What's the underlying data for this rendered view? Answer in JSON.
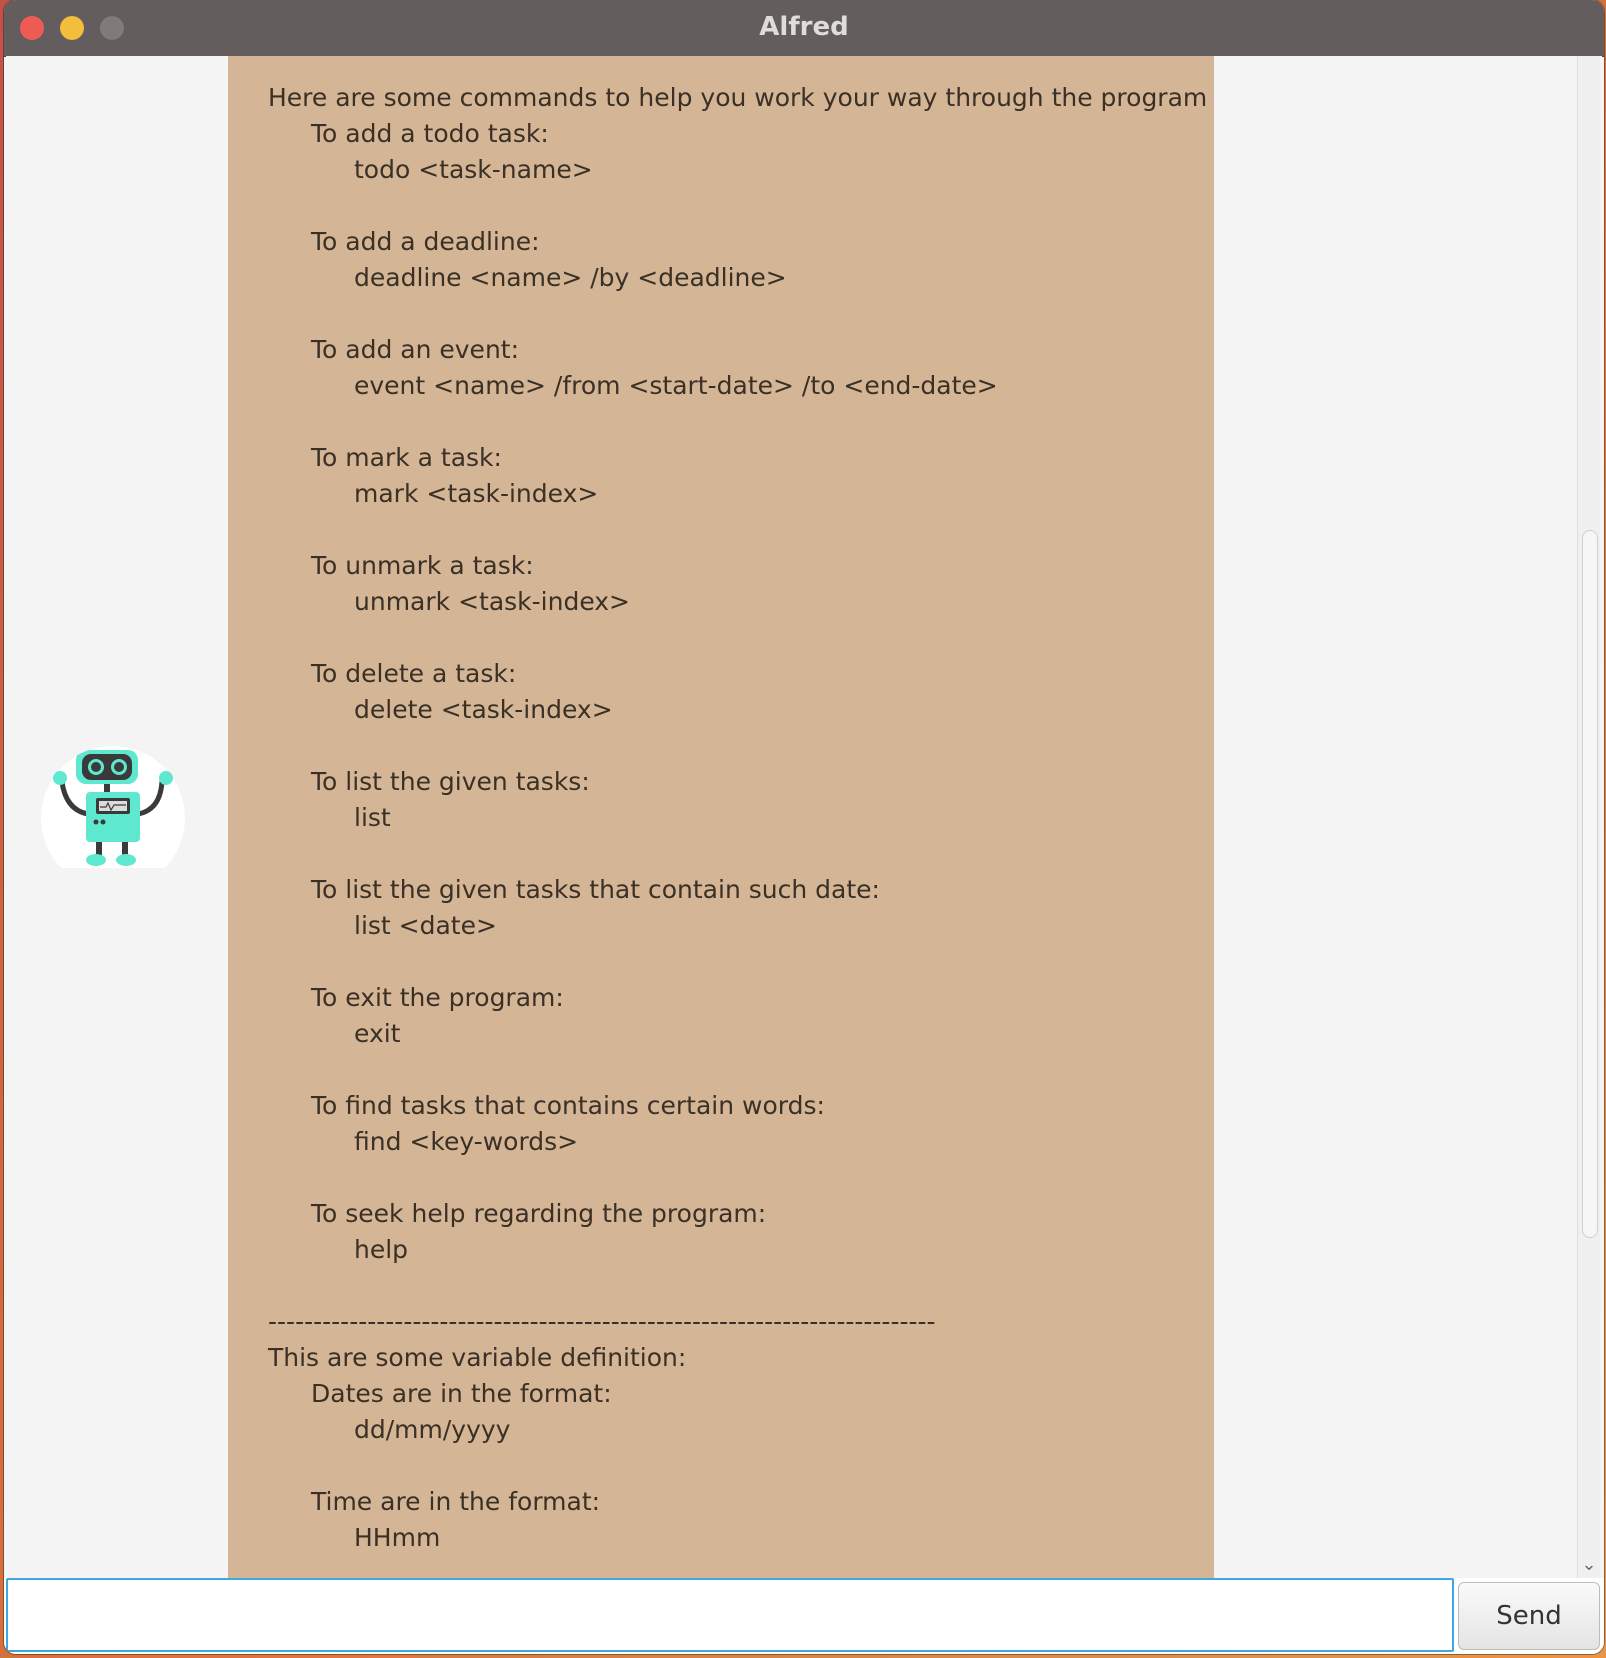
{
  "window": {
    "title": "Alfred",
    "traffic_lights": [
      "close",
      "minimize",
      "maximize"
    ]
  },
  "chat": {
    "avatar": {
      "icon": "robot-icon",
      "colors": {
        "body": "#5ee8cf",
        "outline": "#3a3a3a"
      }
    },
    "bubble_color": "#d4b696",
    "message_lines": [
      {
        "text": "--------------------------------------------------------------------------",
        "indent": 0,
        "cut": true
      },
      {
        "text": "Here are some commands to help you work your way through the program :)",
        "indent": 0
      },
      {
        "text": "To add a todo task:",
        "indent": 1
      },
      {
        "text": "todo <task-name>",
        "indent": 2
      },
      {
        "text": "",
        "indent": 0
      },
      {
        "text": "To add a deadline:",
        "indent": 1
      },
      {
        "text": "deadline <name> /by <deadline>",
        "indent": 2
      },
      {
        "text": "",
        "indent": 0
      },
      {
        "text": "To add an event:",
        "indent": 1
      },
      {
        "text": "event <name> /from <start-date> /to <end-date>",
        "indent": 2
      },
      {
        "text": "",
        "indent": 0
      },
      {
        "text": "To mark a task:",
        "indent": 1
      },
      {
        "text": "mark <task-index>",
        "indent": 2
      },
      {
        "text": "",
        "indent": 0
      },
      {
        "text": "To unmark a task:",
        "indent": 1
      },
      {
        "text": "unmark <task-index>",
        "indent": 2
      },
      {
        "text": "",
        "indent": 0
      },
      {
        "text": "To delete a task:",
        "indent": 1
      },
      {
        "text": "delete <task-index>",
        "indent": 2
      },
      {
        "text": "",
        "indent": 0
      },
      {
        "text": "To list the given tasks:",
        "indent": 1
      },
      {
        "text": "list",
        "indent": 2
      },
      {
        "text": "",
        "indent": 0
      },
      {
        "text": "To list the given tasks that contain such date:",
        "indent": 1
      },
      {
        "text": "list <date>",
        "indent": 2
      },
      {
        "text": "",
        "indent": 0
      },
      {
        "text": "To exit the program:",
        "indent": 1
      },
      {
        "text": "exit",
        "indent": 2
      },
      {
        "text": "",
        "indent": 0
      },
      {
        "text": "To find tasks that contains certain words:",
        "indent": 1
      },
      {
        "text": "find <key-words>",
        "indent": 2
      },
      {
        "text": "",
        "indent": 0
      },
      {
        "text": "To seek help regarding the program:",
        "indent": 1
      },
      {
        "text": "help",
        "indent": 2
      },
      {
        "text": "",
        "indent": 0
      },
      {
        "text": "--------------------------------------------------------------------------",
        "indent": 0
      },
      {
        "text": "This are some variable definition:",
        "indent": 0
      },
      {
        "text": "Dates are in the format:",
        "indent": 1
      },
      {
        "text": "dd/mm/yyyy",
        "indent": 2
      },
      {
        "text": "",
        "indent": 0
      },
      {
        "text": "Time are in the format:",
        "indent": 1
      },
      {
        "text": "HHmm",
        "indent": 2
      }
    ]
  },
  "input": {
    "value": "",
    "placeholder": ""
  },
  "send_button": {
    "label": "Send"
  }
}
